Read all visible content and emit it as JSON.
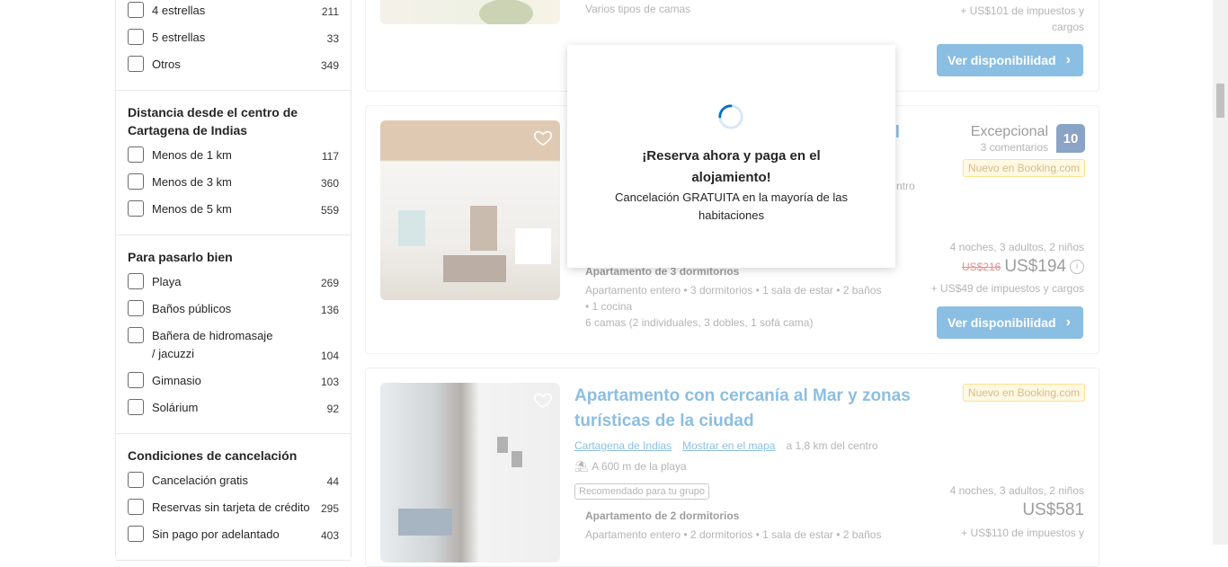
{
  "filters": {
    "stars": [
      {
        "label": "4 estrellas",
        "count": "211"
      },
      {
        "label": "5 estrellas",
        "count": "33"
      },
      {
        "label": "Otros",
        "count": "349"
      }
    ],
    "distance": {
      "title": "Distancia desde el centro de Cartagena de Indias",
      "items": [
        {
          "label": "Menos de 1 km",
          "count": "117"
        },
        {
          "label": "Menos de 3 km",
          "count": "360"
        },
        {
          "label": "Menos de 5 km",
          "count": "559"
        }
      ]
    },
    "fun": {
      "title": "Para pasarlo bien",
      "items": [
        {
          "label": "Playa",
          "count": "269"
        },
        {
          "label": "Baños públicos",
          "count": "136"
        },
        {
          "label": "Bañera de hidromasaje / jacuzzi",
          "count": "104"
        },
        {
          "label": "Gimnasio",
          "count": "103"
        },
        {
          "label": "Solárium",
          "count": "92"
        }
      ]
    },
    "cancel": {
      "title": "Condiciones de cancelación",
      "items": [
        {
          "label": "Cancelación gratis",
          "count": "44"
        },
        {
          "label": "Reservas sin tarjeta de crédito",
          "count": "295"
        },
        {
          "label": "Sin pago por adelantado",
          "count": "403"
        }
      ]
    }
  },
  "card1": {
    "beds": "Varios tipos de camas",
    "taxes": "+ US$101 de impuestos y cargos",
    "button": "Ver disponibilidad"
  },
  "card2": {
    "title_partial": "al",
    "rating_word": "Excepcional",
    "reviews": "3 comentarios",
    "score": "10",
    "new_badge": "Nuevo en Booking.com",
    "distance_partial": "ntro",
    "stay": "4 noches, 3 adultos, 2 niños",
    "old_price": "US$216",
    "price": "US$194",
    "taxes": "+ US$49 de impuestos y cargos",
    "unit_title": "Apartamento de 3 dormitorios",
    "unit_desc": "Apartamento entero • 3 dormitorios • 1 sala de estar • 2 baños",
    "unit_desc2": "• 1 cocina",
    "beds": "6 camas (2 individuales, 3 dobles, 1 sofá cama)",
    "button": "Ver disponibilidad"
  },
  "card3": {
    "title": "Apartamento con cercanía al Mar y zonas turísticas de la ciudad",
    "city": "Cartagena de Indias",
    "map": "Mostrar en el mapa",
    "distance": "a 1,8 km del centro",
    "beach": "A 600 m de la playa",
    "group": "Recomendado para tu grupo",
    "new_badge": "Nuevo en Booking.com",
    "unit_title": "Apartamento de 2 dormitorios",
    "unit_desc": "Apartamento entero • 2 dormitorios • 1 sala de estar • 2 baños",
    "stay": "4 noches, 3 adultos, 2 niños",
    "price": "US$581",
    "taxes": "+ US$110 de impuestos y"
  },
  "modal": {
    "title": "¡Reserva ahora y paga en el alojamiento!",
    "subtitle": "Cancelación GRATUITA en la mayoría de las habitaciones"
  }
}
